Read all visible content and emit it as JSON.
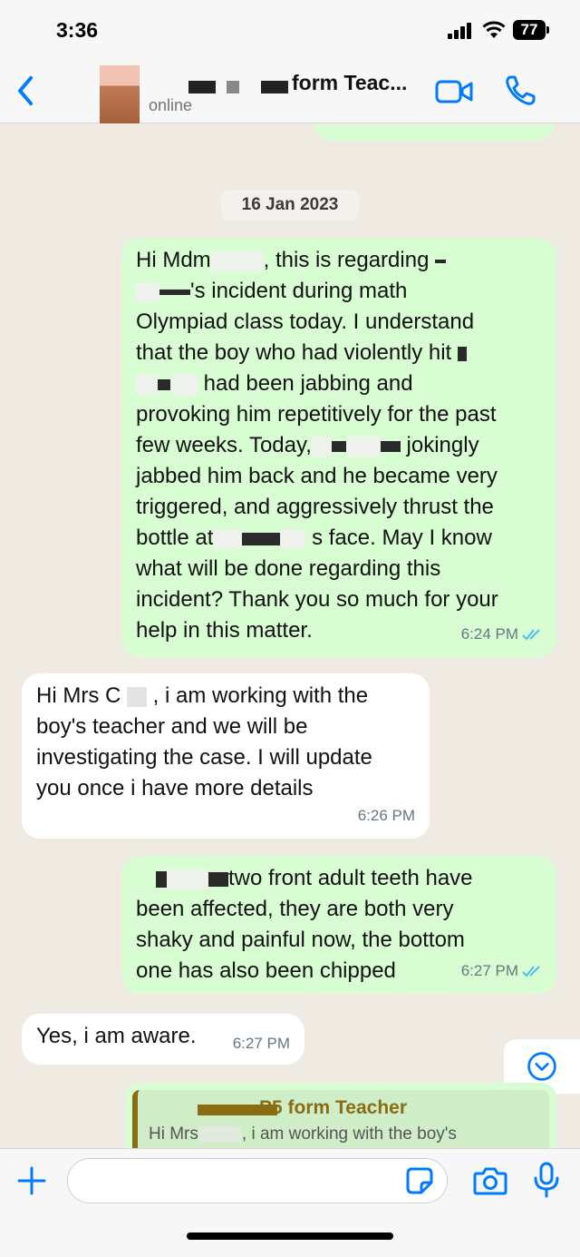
{
  "status": {
    "time": "3:36",
    "battery": "77"
  },
  "header": {
    "contact_name": "form Teac...",
    "contact_status": "online"
  },
  "chat": {
    "date": "16 Jan 2023",
    "msg1": {
      "p1": "Hi Mdm",
      "p2": ", this is regarding",
      "p3": "'s incident during math",
      "p4": "Olympiad class today. I understand",
      "p5": "that the boy who had violently hit",
      "p6": "had been jabbing and",
      "p7": "provoking him repetitively for the past",
      "p8": "few weeks. Today,",
      "p9": "jokingly",
      "p10": "jabbed him back and he became very",
      "p11": "triggered, and aggressively thrust the",
      "p12": "bottle at",
      "p13": "s face. May I know",
      "p14": "what will be done regarding this",
      "p15": "incident? Thank you so much for your",
      "p16": "help in this matter.",
      "time": "6:24 PM"
    },
    "msg2": {
      "p1": "Hi Mrs C",
      "p2": ", i am working with the",
      "p3": "boy's teacher and we will be",
      "p4": "investigating the case. I will update",
      "p5": "you once i have more details",
      "time": "6:26 PM"
    },
    "msg3": {
      "p1": "two front adult teeth have",
      "p2": "been affected, they are both very",
      "p3": "shaky and painful now, the bottom",
      "p4": "one has also been chipped",
      "time": "6:27 PM"
    },
    "msg4": {
      "p1": "Yes, i am aware.",
      "time": "6:27 PM"
    },
    "reply_preview": {
      "title": "P5 form Teacher",
      "text_a": "Hi Mrs",
      "text_b": "i am working with the boy's"
    }
  },
  "colors": {
    "outgoing_bubble": "#d9fdd3",
    "incoming_bubble": "#ffffff",
    "chat_background": "#efeae2",
    "accent_blue": "#007aff",
    "read_ticks": "#53bdeb"
  },
  "icons": [
    "back-icon",
    "video-call-icon",
    "voice-call-icon",
    "scroll-down-icon",
    "plus-icon",
    "sticker-icon",
    "camera-icon",
    "microphone-icon"
  ]
}
